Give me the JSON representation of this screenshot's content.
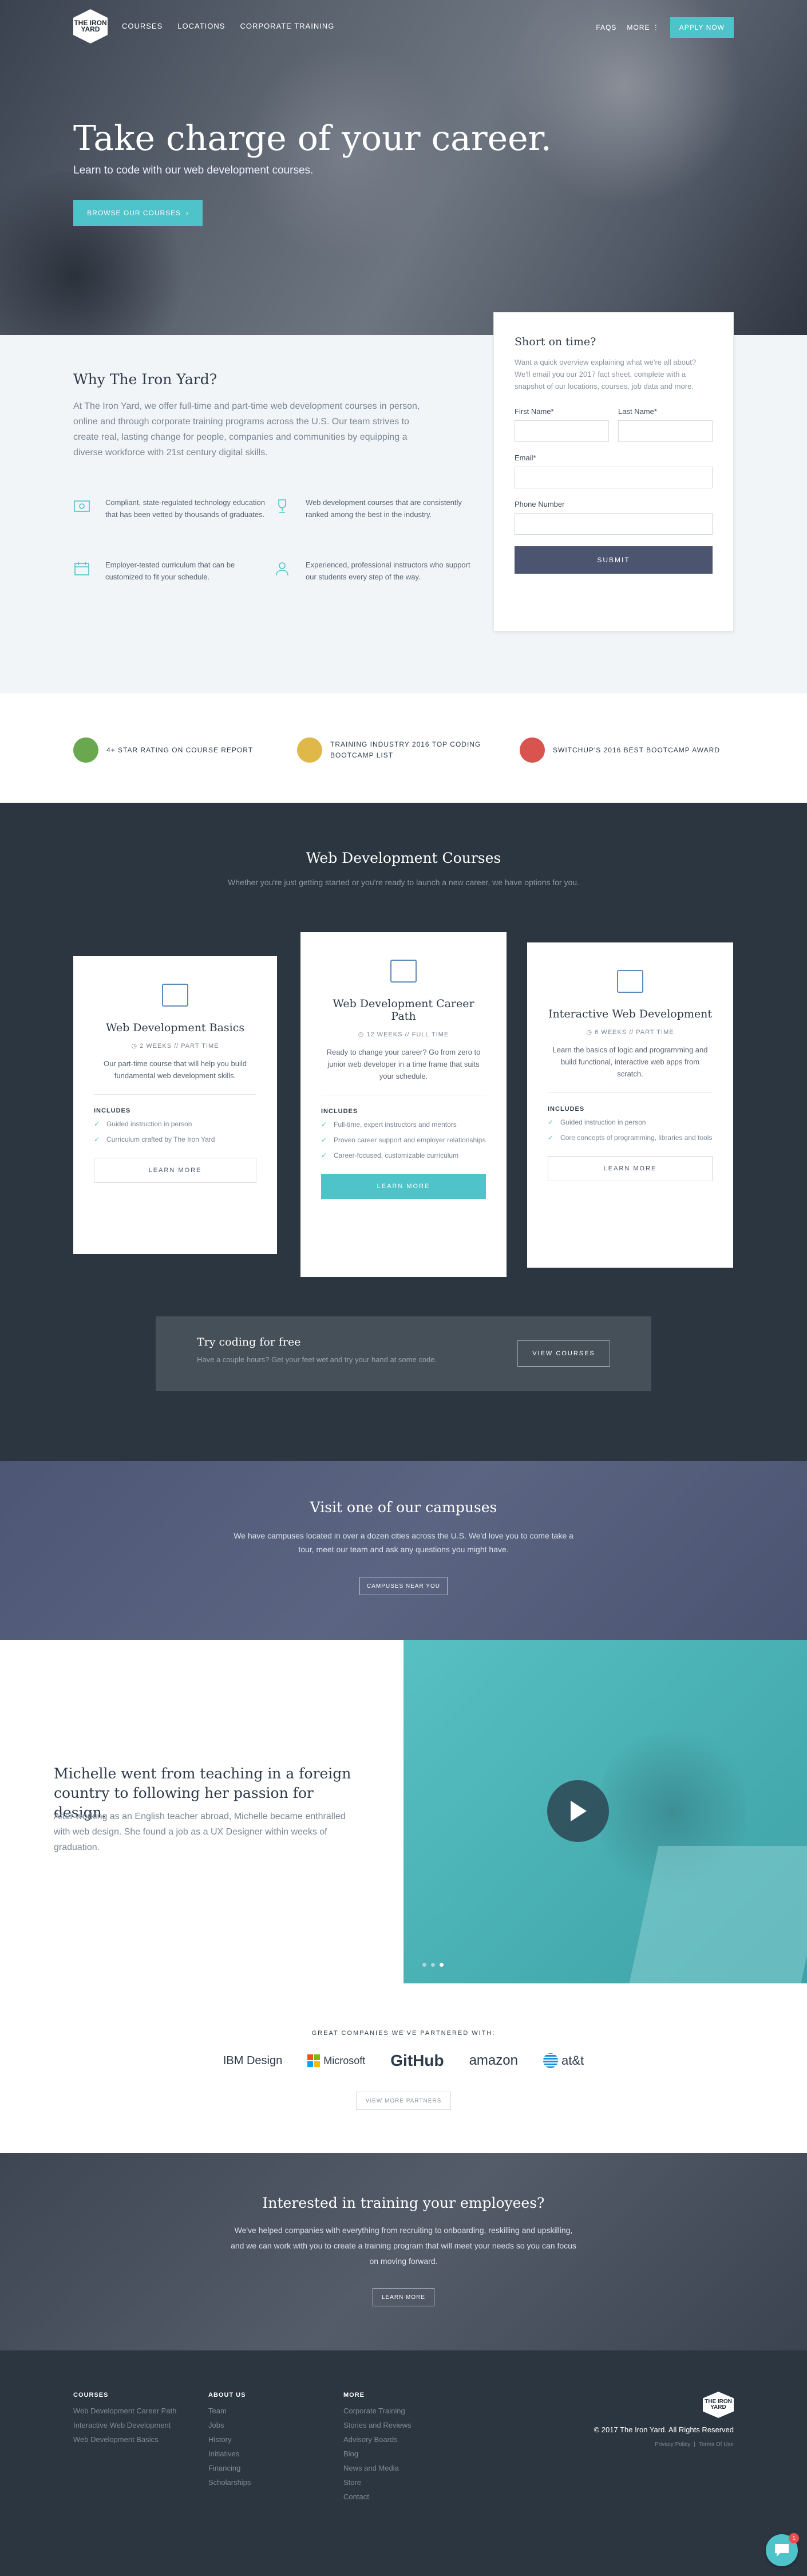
{
  "nav": {
    "logo_text": "THE IRON YARD",
    "links": [
      "COURSES",
      "LOCATIONS",
      "CORPORATE TRAINING"
    ],
    "faq": "FAQS",
    "more": "MORE",
    "apply": "APPLY NOW"
  },
  "hero": {
    "title": "Take charge of your career.",
    "subtitle": "Learn to code with our web development courses.",
    "button": "BROWSE OUR COURSES"
  },
  "why": {
    "title": "Why The Iron Yard?",
    "intro": "At The Iron Yard, we offer full-time and part-time web development courses in person, online and through corporate training programs across the U.S. Our team strives to create real, lasting change for people, companies and communities by equipping a diverse workforce with 21st century digital skills.",
    "features": [
      {
        "icon": "certificate-icon",
        "text": "Compliant, state-regulated technology education that has been vetted by thousands of graduates."
      },
      {
        "icon": "trophy-icon",
        "text": "Web development courses that are consistently ranked among the best in the industry."
      },
      {
        "icon": "calendar-icon",
        "text": "Employer-tested curriculum that can be customized to fit your schedule."
      },
      {
        "icon": "people-icon",
        "text": "Experienced, professional instructors who support our students every step of the way."
      }
    ]
  },
  "form": {
    "title": "Short on time?",
    "description": "Want a quick overview explaining what we're all about? We'll email you our 2017 fact sheet, complete with a snapshot of our locations, courses, job data and more.",
    "first_name": "First Name*",
    "last_name": "Last Name*",
    "email": "Email*",
    "phone": "Phone Number",
    "submit": "SUBMIT"
  },
  "awards": [
    {
      "text": "4+ STAR RATING ON COURSE REPORT",
      "color": "#6aa84f"
    },
    {
      "text": "TRAINING INDUSTRY 2016 TOP CODING BOOTCAMP LIST",
      "color": "#e0b84a"
    },
    {
      "text": "SWITCHUP'S 2016 BEST BOOTCAMP AWARD",
      "color": "#d9534f"
    }
  ],
  "courses": {
    "title": "Web Development Courses",
    "subtitle": "Whether you're just getting started or you're ready to launch a new career, we have options for you.",
    "includes_label": "INCLUDES",
    "items": [
      {
        "title": "Web Development Basics",
        "duration": "2 WEEKS // PART TIME",
        "description": "Our part-time course that will help you build fundamental web development skills.",
        "includes": [
          "Guided instruction in person",
          "Curriculum crafted by The Iron Yard"
        ],
        "button": "LEARN MORE"
      },
      {
        "title": "Web Development Career Path",
        "duration": "12 WEEKS // FULL TIME",
        "description": "Ready to change your career? Go from zero to junior web developer in a time frame that suits your schedule.",
        "includes": [
          "Full-time, expert instructors and mentors",
          "Proven career support and employer relationships",
          "Career-focused, customizable curriculum"
        ],
        "button": "LEARN MORE"
      },
      {
        "title": "Interactive Web Development",
        "duration": "6 WEEKS // PART TIME",
        "description": "Learn the basics of logic and programming and build functional, interactive web apps from scratch.",
        "includes": [
          "Guided instruction in person",
          "Core concepts of programming, libraries and tools"
        ],
        "button": "LEARN MORE"
      }
    ],
    "try": {
      "title": "Try coding for free",
      "text": "Have a couple hours? Get your feet wet and try your hand at some code.",
      "button": "VIEW COURSES"
    }
  },
  "campus": {
    "title": "Visit one of our campuses",
    "text": "We have campuses located in over a dozen cities across the U.S. We'd love you to come take a tour, meet our team and ask any questions you might have.",
    "button": "CAMPUSES NEAR YOU"
  },
  "story": {
    "title": "Michelle went from teaching in a foreign country to following her passion for design.",
    "text": "After working as an English teacher abroad, Michelle became enthralled with web design. She found a job as a UX Designer within weeks of graduation."
  },
  "partners": {
    "label": "GREAT COMPANIES WE'VE PARTNERED WITH:",
    "logos": [
      "IBM Design",
      "Microsoft",
      "GitHub",
      "amazon",
      "at&t"
    ],
    "button": "VIEW MORE PARTNERS"
  },
  "training": {
    "title": "Interested in training your employees?",
    "text": "We've helped companies with everything from recruiting to onboarding, reskilling and upskilling, and we can work with you to create a training program that will meet your needs so you can focus on moving forward.",
    "button": "LEARN MORE"
  },
  "footer": {
    "columns": [
      {
        "title": "COURSES",
        "links": [
          "Web Development Career Path",
          "Interactive Web Development",
          "Web Development Basics"
        ]
      },
      {
        "title": "ABOUT US",
        "links": [
          "Team",
          "Jobs",
          "History",
          "Initiatives",
          "Financing",
          "Scholarships"
        ]
      },
      {
        "title": "MORE",
        "links": [
          "Corporate Training",
          "Stories and Reviews",
          "Advisory Boards",
          "Blog",
          "News and Media",
          "Store",
          "Contact"
        ]
      }
    ],
    "copyright": "© 2017 The Iron Yard. All Rights Reserved",
    "privacy": "Privacy Policy",
    "terms": "Terms Of Use",
    "chat_badge": "1"
  }
}
